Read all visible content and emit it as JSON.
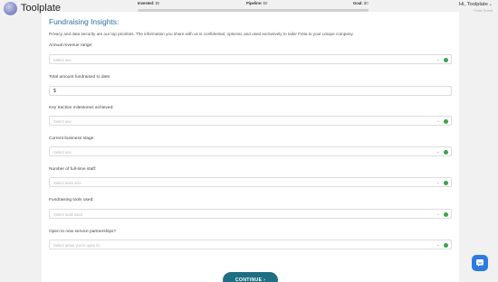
{
  "header": {
    "brand": "Toolplate",
    "progress": [
      {
        "label": "Invested:",
        "value": "$0"
      },
      {
        "label": "Pipeline:",
        "value": "$0"
      },
      {
        "label": "Goal:",
        "value": "$0"
      }
    ],
    "user": {
      "greeting": "Hi, Toolplate",
      "subtext": "Finta Guest"
    }
  },
  "form": {
    "title": "Fundraising Insights:",
    "description": "Privacy and data security are our top priorities. The information you share with us is confidential, optional, and used exclusively to tailor Finta to your unique company.",
    "fields": [
      {
        "label": "Annual revenue range:",
        "placeholder": "Select one"
      },
      {
        "label": "Total amount fundraised to date:",
        "value": "$"
      },
      {
        "label": "Key traction milestones achieved:",
        "placeholder": "Select one"
      },
      {
        "label": "Current business stage:",
        "placeholder": "Select one"
      },
      {
        "label": "Number of full-time staff:",
        "placeholder": "Select team size"
      },
      {
        "label": "Fundraising tools used:",
        "placeholder": "Select tools used"
      },
      {
        "label": "Open to new service partnerships?",
        "placeholder": "Select areas you're open to"
      }
    ],
    "continue_label": "CONTINUE ›"
  },
  "colors": {
    "accent": "#1f6f84",
    "title": "#2f6fa3",
    "check": "#3ca34a",
    "chat": "#2d7be0"
  }
}
